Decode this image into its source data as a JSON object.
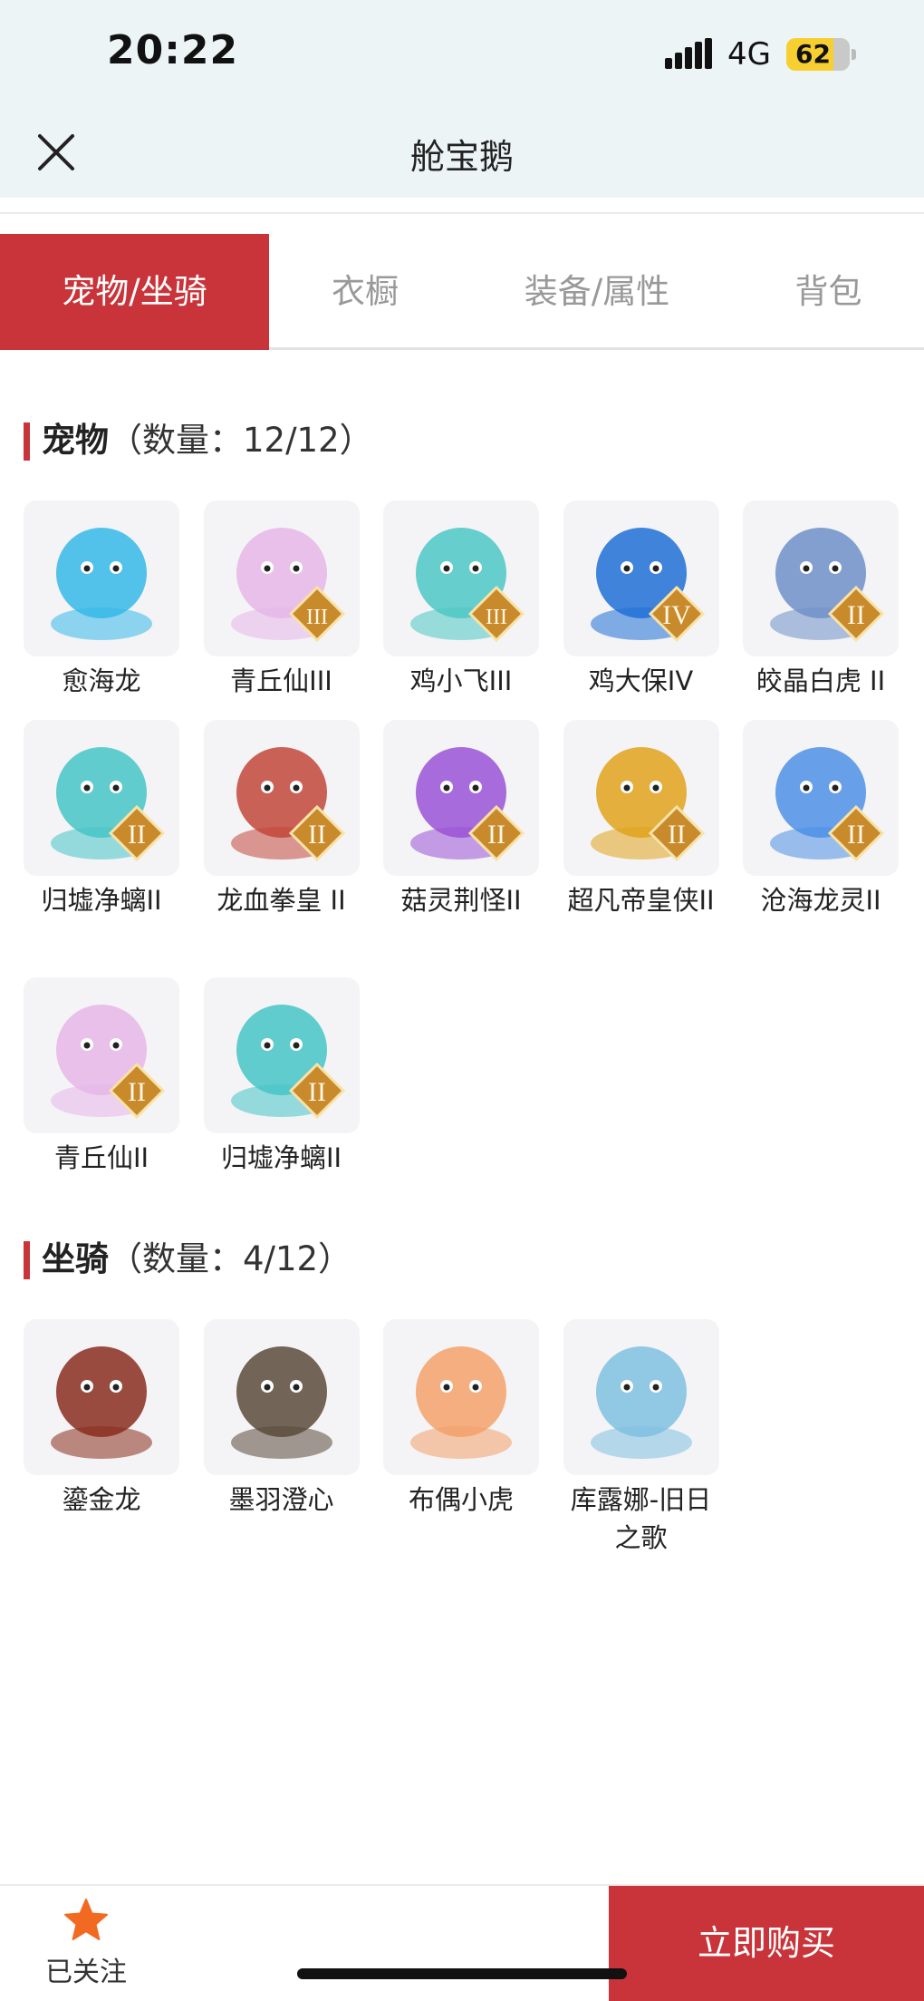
{
  "status_bar": {
    "time": "20:22",
    "network": "4G",
    "battery": "62"
  },
  "header": {
    "title": "舱宝鹅"
  },
  "tabs": [
    {
      "label": "宠物/坐骑",
      "active": true
    },
    {
      "label": "衣橱",
      "active": false
    },
    {
      "label": "装备/属性",
      "active": false
    },
    {
      "label": "背包",
      "active": false
    }
  ],
  "pets": {
    "title": "宠物",
    "count": "（数量：12/12）",
    "items": [
      {
        "name": "愈海龙",
        "badge": "",
        "color": "#35b8e8"
      },
      {
        "name": "青丘仙III",
        "badge": "III",
        "color": "#e6b6e8"
      },
      {
        "name": "鸡小飞III",
        "badge": "III",
        "color": "#4cc7c4"
      },
      {
        "name": "鸡大保IV",
        "badge": "IV",
        "color": "#1f6fd6"
      },
      {
        "name": "皎晶白虎 II",
        "badge": "II",
        "color": "#6f8fc8"
      },
      {
        "name": "归墟净螭II",
        "badge": "II",
        "color": "#46c4c6"
      },
      {
        "name": "龙血拳皇 II",
        "badge": "II",
        "color": "#c2473a"
      },
      {
        "name": "菇灵荆怪II",
        "badge": "II",
        "color": "#9a52d6"
      },
      {
        "name": "超凡帝皇侠II",
        "badge": "II",
        "color": "#e0a21c"
      },
      {
        "name": "沧海龙灵II",
        "badge": "II",
        "color": "#4d8fe6"
      },
      {
        "name": "青丘仙II",
        "badge": "II",
        "color": "#e6b6e8"
      },
      {
        "name": "归墟净螭II",
        "badge": "II",
        "color": "#46c4c6"
      }
    ]
  },
  "mounts": {
    "title": "坐骑",
    "count": "（数量：4/12）",
    "items": [
      {
        "name": "鎏金龙",
        "badge": "",
        "color": "#8a2d1e"
      },
      {
        "name": "墨羽澄心",
        "badge": "",
        "color": "#5a4a3a"
      },
      {
        "name": "布偶小虎",
        "badge": "",
        "color": "#f3a16a"
      },
      {
        "name": "库露娜-旧日之歌",
        "badge": "",
        "color": "#7fc0e0"
      }
    ]
  },
  "bottom_bar": {
    "follow_label": "已关注",
    "buy_label": "立即购买"
  },
  "colors": {
    "accent": "#c8343a",
    "badge_gold": "#c98a2c",
    "star": "#f26a21"
  }
}
